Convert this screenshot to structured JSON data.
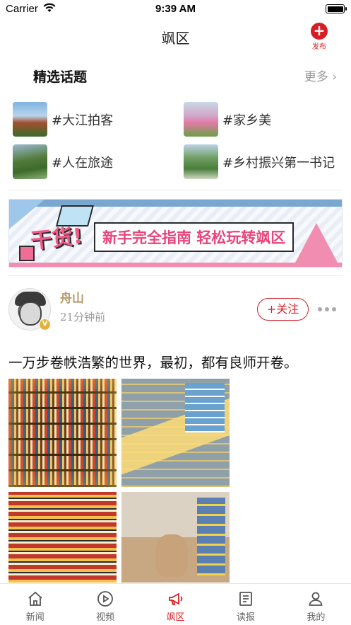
{
  "status_bar": {
    "carrier": "Carrier",
    "time": "9:39 AM"
  },
  "nav": {
    "title": "飒区",
    "publish_label": "发布",
    "publish_icon": "plus-circle-icon"
  },
  "topics_section": {
    "title": "精选话题",
    "more_label": "更多 ›",
    "items": [
      {
        "label": "#大江拍客"
      },
      {
        "label": "#家乡美"
      },
      {
        "label": "#人在旅途"
      },
      {
        "label": "#乡村振兴第一书记"
      }
    ]
  },
  "banner": {
    "badge": "干货!",
    "headline": "新手完全指南 轻松玩转飒区"
  },
  "post": {
    "author": "舟山",
    "verified_mark": "V",
    "time": "21分钟前",
    "follow_label": "+关注",
    "text": "一万步卷帙浩繁的世界，最初，都有良师开卷。"
  },
  "tabs": [
    {
      "label": "新闻",
      "icon": "home-icon",
      "active": false
    },
    {
      "label": "视频",
      "icon": "play-circle-icon",
      "active": false
    },
    {
      "label": "飒区",
      "icon": "megaphone-icon",
      "active": true
    },
    {
      "label": "读报",
      "icon": "newspaper-icon",
      "active": false
    },
    {
      "label": "我的",
      "icon": "user-icon",
      "active": false
    }
  ],
  "colors": {
    "accent": "#d81e25",
    "author_name": "#b89a6a",
    "muted": "#999999"
  }
}
